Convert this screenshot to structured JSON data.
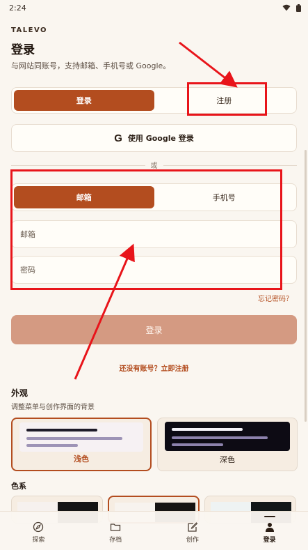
{
  "status": {
    "time": "2:24"
  },
  "header": {
    "brand": "TALEVO",
    "title": "登录",
    "subtitle": "与网站同账号，支持邮箱、手机号或 Google。"
  },
  "auth_tabs": {
    "login": "登录",
    "register": "注册"
  },
  "google_button": {
    "icon_letter": "G",
    "label": "使用 Google 登录"
  },
  "divider_text": "或",
  "method_tabs": {
    "email": "邮箱",
    "phone": "手机号"
  },
  "fields": {
    "email_placeholder": "邮箱",
    "password_placeholder": "密码"
  },
  "forgot_password": "忘记密码？",
  "login_button": "登录",
  "signup_link": "还没有账号？立即注册",
  "appearance": {
    "title": "外观",
    "subtitle": "调整菜单与创作界面的背景",
    "light_label": "浅色",
    "dark_label": "深色"
  },
  "color_scheme": {
    "title": "色系"
  },
  "bottom_nav": {
    "items": [
      {
        "label": "探索",
        "icon": "compass-icon"
      },
      {
        "label": "存档",
        "icon": "folder-icon"
      },
      {
        "label": "创作",
        "icon": "edit-icon"
      },
      {
        "label": "登录",
        "icon": "person-icon"
      }
    ]
  },
  "colors": {
    "accent": "#b34d1f",
    "annotation_red": "#e8141a",
    "background": "#faf6f0"
  }
}
